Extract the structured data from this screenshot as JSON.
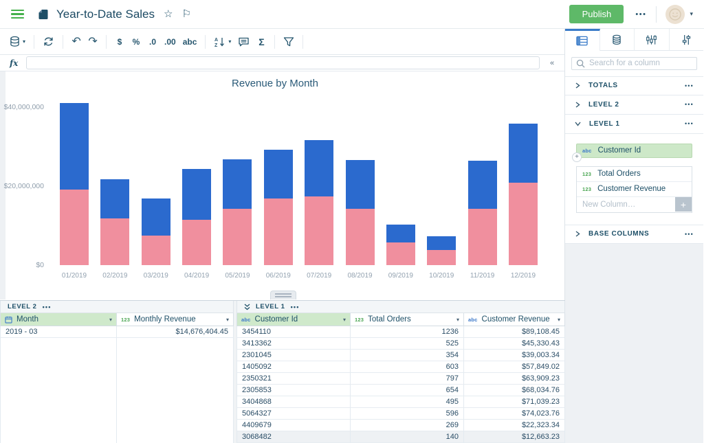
{
  "topbar": {
    "title": "Year-to-Date Sales",
    "publish_label": "Publish"
  },
  "icons": {
    "more": "•••",
    "caret_down": "▾",
    "collapse_left": "«",
    "star": "☆",
    "flag": "⚐",
    "undo": "↶",
    "redo": "↷",
    "currency": "$",
    "percent": "%",
    "decimal_decrease": ".0",
    "decimal_increase": ".00",
    "text_format": "abc",
    "sigma": "Σ",
    "fx": "fx",
    "plus": "+",
    "text_type": "abc",
    "number_type": "123"
  },
  "formula_bar": {
    "value": ""
  },
  "chart_data": {
    "type": "bar",
    "stacked": true,
    "title": "Revenue by Month",
    "categories": [
      "01/2019",
      "02/2019",
      "03/2019",
      "04/2019",
      "05/2019",
      "06/2019",
      "07/2019",
      "08/2019",
      "09/2019",
      "10/2019",
      "11/2019",
      "12/2019"
    ],
    "series": [
      {
        "name": "bottom segment",
        "color": "#f08f9e",
        "values_usd_millions": [
          19.1,
          11.8,
          7.4,
          11.5,
          14.3,
          16.9,
          17.4,
          14.3,
          5.8,
          3.8,
          14.3,
          20.8
        ]
      },
      {
        "name": "top segment",
        "color": "#2b6ace",
        "values_usd_millions": [
          21.9,
          10.0,
          9.5,
          12.8,
          12.4,
          12.3,
          14.2,
          12.3,
          4.5,
          3.5,
          12.2,
          15.0
        ]
      }
    ],
    "xlabel": "",
    "ylabel": "",
    "y_ticks": [
      "$40,000,000",
      "$20,000,000",
      "$0"
    ],
    "ylim_usd_millions": [
      0,
      43.5
    ],
    "grid": false,
    "legend": false
  },
  "sidebar": {
    "search_placeholder": "Search for a column",
    "panels": {
      "totals_label": "TOTALS",
      "level2_label": "LEVEL 2",
      "level1_label": "LEVEL 1",
      "base_columns_label": "BASE COLUMNS"
    },
    "level1_group_column": {
      "type": "abc",
      "name": "Customer Id"
    },
    "level1_columns": [
      {
        "type": "123",
        "name": "Total Orders"
      },
      {
        "type": "123",
        "name": "Customer Revenue"
      }
    ],
    "new_column_placeholder": "New Column…"
  },
  "bottom_tables": {
    "level2": {
      "title": "LEVEL 2",
      "columns": [
        {
          "type": "date",
          "name": "Month",
          "grouped": true
        },
        {
          "type": "123",
          "name": "Monthly Revenue",
          "grouped": false
        }
      ],
      "rows": [
        [
          "2019 - 03",
          "$14,676,404.45"
        ]
      ]
    },
    "level1": {
      "title": "LEVEL 1",
      "columns": [
        {
          "type": "abc",
          "name": "Customer Id",
          "grouped": true
        },
        {
          "type": "123",
          "name": "Total Orders",
          "grouped": false
        },
        {
          "type": "abc",
          "name": "Customer Revenue",
          "grouped": false
        }
      ],
      "rows": [
        [
          "3454110",
          "1236",
          "$89,108.45"
        ],
        [
          "3413362",
          "525",
          "$45,330.43"
        ],
        [
          "2301045",
          "354",
          "$39,003.34"
        ],
        [
          "1405092",
          "603",
          "$57,849.02"
        ],
        [
          "2350321",
          "797",
          "$63,909.23"
        ],
        [
          "2305853",
          "654",
          "$68,034.76"
        ],
        [
          "3404868",
          "495",
          "$71,039.23"
        ],
        [
          "5064327",
          "596",
          "$74,023.76"
        ],
        [
          "4409679",
          "269",
          "$22,323.34"
        ],
        [
          "3068482",
          "140",
          "$12,663.23"
        ]
      ]
    }
  },
  "colors": {
    "brand_navy": "#1d4f67",
    "accent_green": "#5eb968",
    "menu_green": "#43b04a",
    "chart_blue": "#2b6ace",
    "chart_pink": "#f08f9e",
    "grouped_header_green": "#cfe9cb",
    "type_blue": "#3b78c9",
    "type_green": "#4aa552",
    "active_tab_blue": "#3a7bc8"
  }
}
